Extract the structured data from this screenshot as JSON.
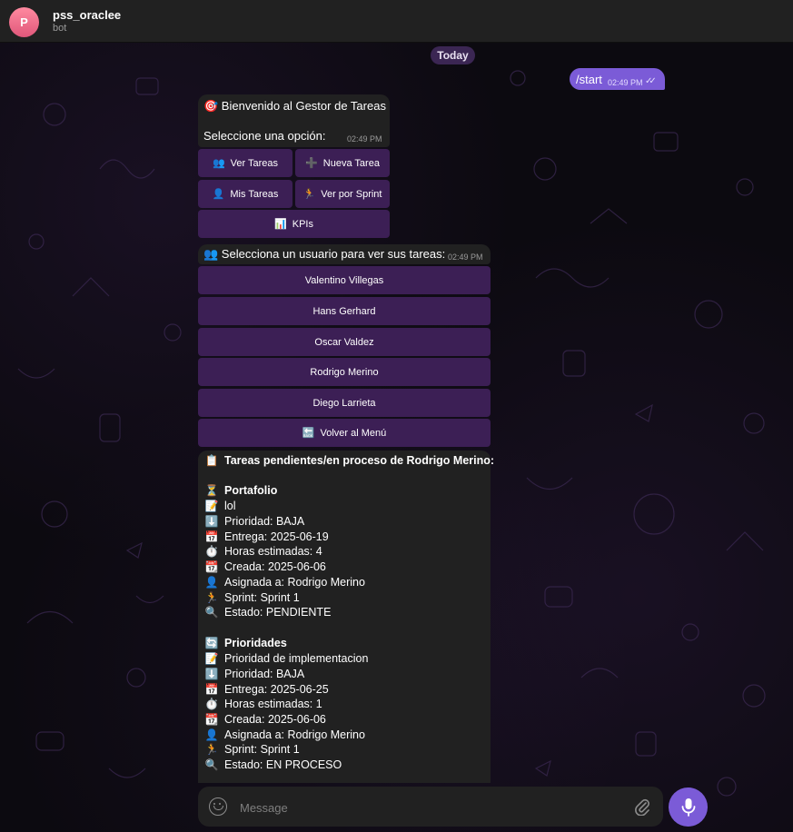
{
  "header": {
    "avatar_letter": "P",
    "title": "pss_oraclee",
    "subtitle": "bot"
  },
  "day_separator": "Today",
  "outgoing": {
    "text": "/start",
    "time": "02:49 PM"
  },
  "message1": {
    "line1": "🎯 Bienvenido al Gestor de Tareas",
    "line2": "Seleccione una opción:",
    "time": "02:49 PM",
    "buttons": [
      {
        "icon": "👥",
        "label": "Ver Tareas"
      },
      {
        "icon": "➕",
        "label": "Nueva Tarea"
      },
      {
        "icon": "👤",
        "label": "Mis Tareas"
      },
      {
        "icon": "🏃",
        "label": "Ver por Sprint"
      },
      {
        "icon": "📊",
        "label": "KPIs"
      }
    ]
  },
  "message2": {
    "line1": "👥 Selecciona un usuario para ver sus tareas:",
    "time": "02:49 PM",
    "buttons": [
      {
        "icon": "",
        "label": "Valentino Villegas"
      },
      {
        "icon": "",
        "label": "Hans Gerhard"
      },
      {
        "icon": "",
        "label": "Oscar Valdez"
      },
      {
        "icon": "",
        "label": "Rodrigo Merino"
      },
      {
        "icon": "",
        "label": "Diego Larrieta"
      },
      {
        "icon": "🔙",
        "label": "Volver al Menú"
      }
    ]
  },
  "message3": {
    "heading_icon": "📋",
    "heading": "Tareas pendientes/en proceso de Rodrigo Merino:",
    "tasks": [
      {
        "status_icon": "⏳",
        "name": "Portafolio",
        "desc": "lol",
        "priority": "Prioridad: BAJA",
        "due": "Entrega: 2025-06-19",
        "hours": "Horas estimadas: 4",
        "created": "Creada: 2025-06-06",
        "assigned": "Asignada a: Rodrigo Merino",
        "sprint": "Sprint: Sprint 1",
        "state": "Estado: PENDIENTE"
      },
      {
        "status_icon": "🔄",
        "name": "Prioridades",
        "desc": "Prioridad de implementacion",
        "priority": "Prioridad: BAJA",
        "due": "Entrega: 2025-06-25",
        "hours": "Horas estimadas: 1",
        "created": "Creada: 2025-06-06",
        "assigned": "Asignada a: Rodrigo Merino",
        "sprint": "Sprint: Sprint 1",
        "state": "Estado: EN PROCESO"
      }
    ],
    "icons": {
      "desc": "📝",
      "priority": "⬇️",
      "due": "📅",
      "hours": "⏱️",
      "created": "📆",
      "assigned": "👤",
      "sprint": "🏃",
      "state": "🔍"
    }
  },
  "composer": {
    "placeholder": "Message"
  },
  "colors": {
    "accent": "#7b5bd7",
    "bubble": "#212121",
    "keyboard_button": "#3c1f55"
  }
}
